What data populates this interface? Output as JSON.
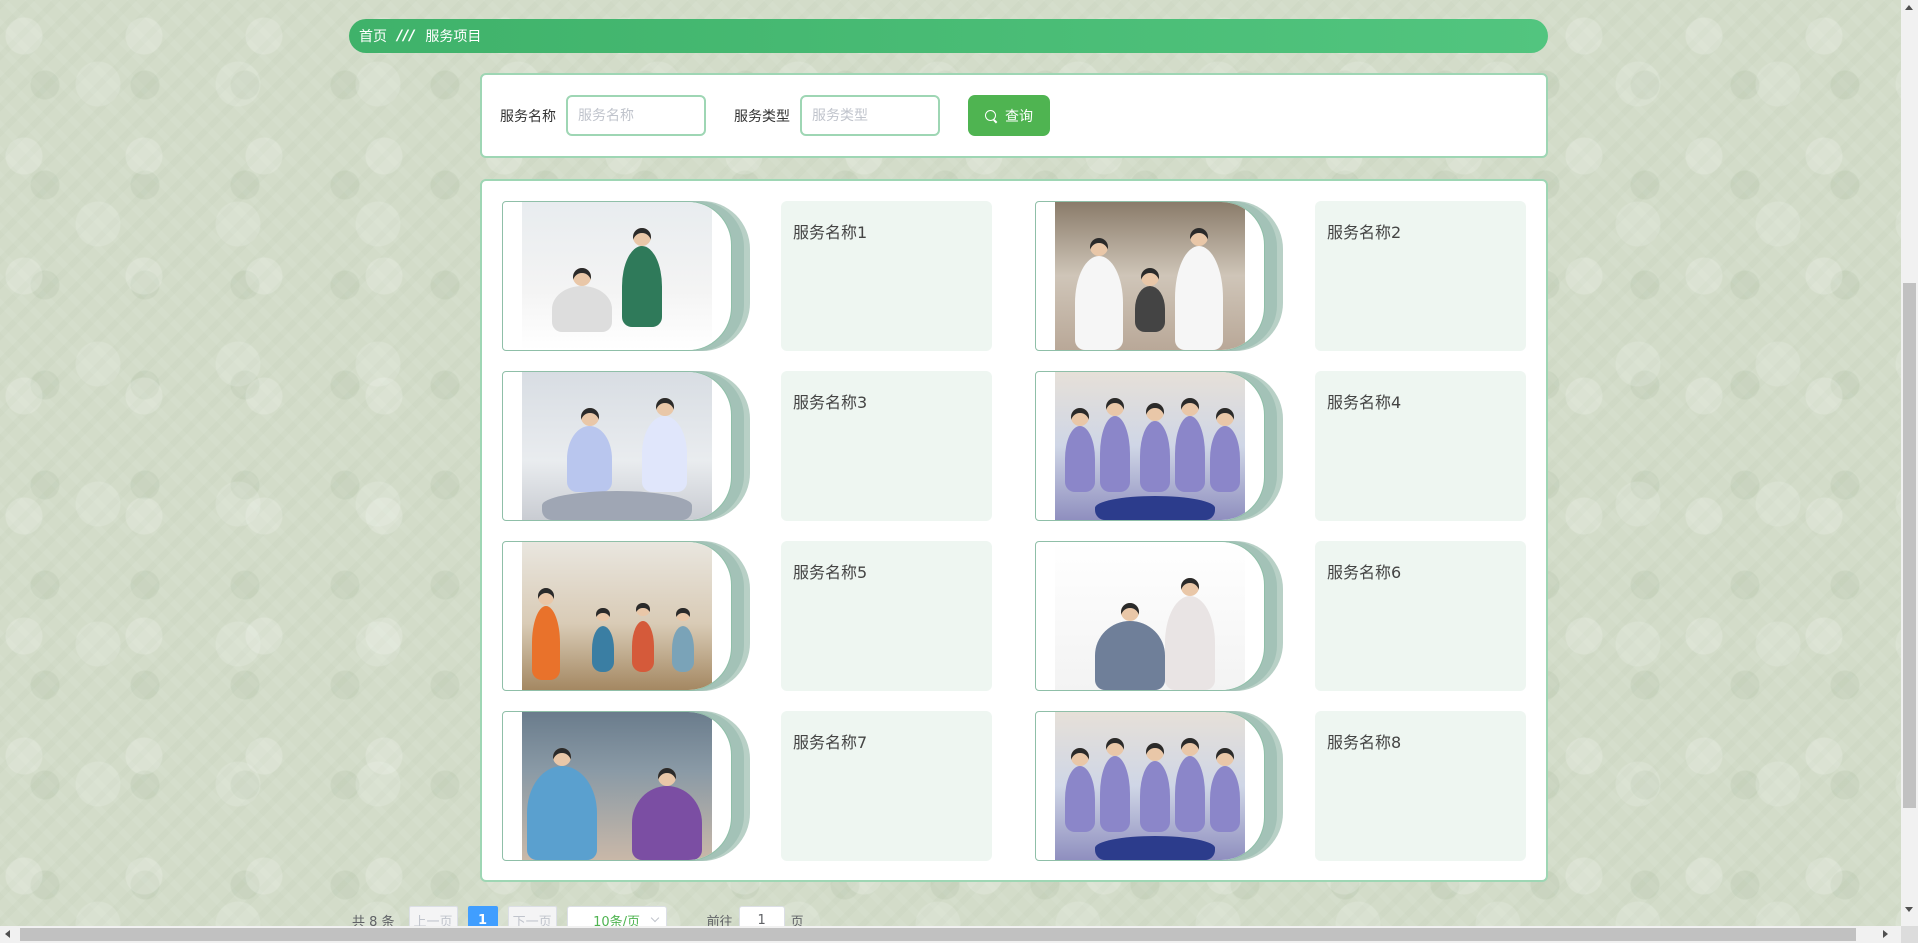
{
  "breadcrumb": {
    "home": "首页",
    "separator": "///",
    "current": "服务项目"
  },
  "search": {
    "name_label": "服务名称",
    "name_placeholder": "服务名称",
    "name_value": "",
    "type_label": "服务类型",
    "type_placeholder": "服务类型",
    "type_value": "",
    "query_label": "查询"
  },
  "items": [
    {
      "name": "服务名称1",
      "photo": "nurse-bedside-photo"
    },
    {
      "name": "服务名称2",
      "photo": "doctors-checkup-photo"
    },
    {
      "name": "服务名称3",
      "photo": "nurses-caring-photo"
    },
    {
      "name": "服务名称4",
      "photo": "training-group-photo"
    },
    {
      "name": "服务名称5",
      "photo": "exercise-class-photo"
    },
    {
      "name": "服务名称6",
      "photo": "caregiver-elder-photo"
    },
    {
      "name": "服务名称7",
      "photo": "caregiver-chat-photo"
    },
    {
      "name": "服务名称8",
      "photo": "training-group-photo"
    }
  ],
  "pagination": {
    "total": "共 8 条",
    "prev": "上一页",
    "current_page": "1",
    "next": "下一页",
    "page_size": "10条/页",
    "goto_label": "前往",
    "goto_value": "1",
    "page_suffix": "页"
  },
  "colors": {
    "accent": "#4fb451",
    "breadcrumb_start": "#3fb26a",
    "breadcrumb_end": "#52c57f",
    "panel_border": "#9ed6b4",
    "name_box_bg": "#eef6f1",
    "page_active": "#409eff"
  }
}
